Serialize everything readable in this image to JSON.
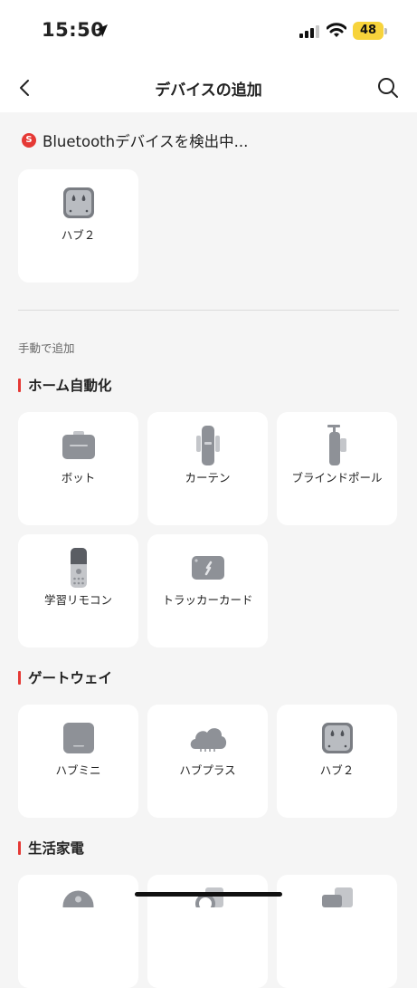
{
  "status_bar": {
    "time": "15:50",
    "battery": "48"
  },
  "nav": {
    "title": "デバイスの追加"
  },
  "scan": {
    "badge": "S",
    "text": "Bluetoothデバイスを検出中..."
  },
  "found_devices": [
    {
      "label": "ハブ２",
      "icon": "hub2-icon"
    }
  ],
  "manual_label": "手動で追加",
  "sections": [
    {
      "title": "ホーム自動化",
      "items": [
        {
          "label": "ボット",
          "icon": "bot-icon"
        },
        {
          "label": "カーテン",
          "icon": "curtain-icon"
        },
        {
          "label": "ブラインドポール",
          "icon": "blind-tilt-icon"
        },
        {
          "label": "学習リモコン",
          "icon": "remote-icon"
        },
        {
          "label": "トラッカーカード",
          "icon": "tracker-card-icon"
        }
      ]
    },
    {
      "title": "ゲートウェイ",
      "items": [
        {
          "label": "ハブミニ",
          "icon": "hub-mini-icon"
        },
        {
          "label": "ハブプラス",
          "icon": "hub-plus-icon"
        },
        {
          "label": "ハブ２",
          "icon": "hub2-icon"
        }
      ]
    },
    {
      "title": "生活家電",
      "items": [
        {
          "label": "",
          "icon": "robot-vacuum-icon"
        },
        {
          "label": "",
          "icon": "appliance-icon"
        },
        {
          "label": "",
          "icon": "appliance-icon"
        }
      ]
    }
  ],
  "colors": {
    "accent": "#e53935",
    "battery": "#f7d33b",
    "device_gray": "#8e9197"
  }
}
